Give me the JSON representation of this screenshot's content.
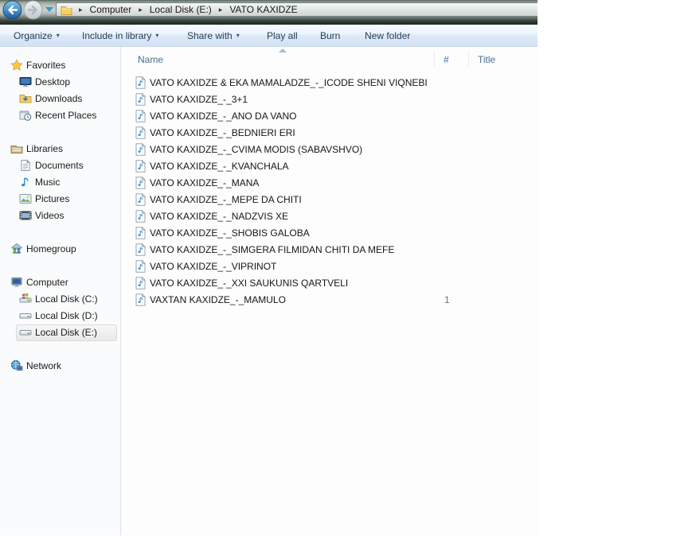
{
  "breadcrumb": {
    "items": [
      "Computer",
      "Local Disk (E:)",
      "VATO KAXIDZE"
    ]
  },
  "toolbar": {
    "items": [
      {
        "label": "Organize",
        "dropdown": true
      },
      {
        "label": "Include in library",
        "dropdown": true
      },
      {
        "label": "Share with",
        "dropdown": true
      },
      {
        "label": "Play all",
        "dropdown": false
      },
      {
        "label": "Burn",
        "dropdown": false
      },
      {
        "label": "New folder",
        "dropdown": false
      }
    ]
  },
  "sidebar": {
    "groups": [
      {
        "label": "Favorites",
        "icon": "favorites-star-icon",
        "children": [
          {
            "label": "Desktop",
            "icon": "desktop-icon"
          },
          {
            "label": "Downloads",
            "icon": "downloads-icon"
          },
          {
            "label": "Recent Places",
            "icon": "recent-places-icon"
          }
        ]
      },
      {
        "label": "Libraries",
        "icon": "libraries-icon",
        "children": [
          {
            "label": "Documents",
            "icon": "documents-icon"
          },
          {
            "label": "Music",
            "icon": "music-icon"
          },
          {
            "label": "Pictures",
            "icon": "pictures-icon"
          },
          {
            "label": "Videos",
            "icon": "videos-icon"
          }
        ]
      },
      {
        "label": "Homegroup",
        "icon": "homegroup-icon",
        "children": []
      },
      {
        "label": "Computer",
        "icon": "computer-icon",
        "children": [
          {
            "label": "Local Disk (C:)",
            "icon": "system-drive-icon"
          },
          {
            "label": "Local Disk (D:)",
            "icon": "drive-icon"
          },
          {
            "label": "Local Disk (E:)",
            "icon": "drive-icon",
            "selected": true
          }
        ]
      },
      {
        "label": "Network",
        "icon": "network-icon",
        "children": []
      }
    ]
  },
  "main": {
    "columns": [
      {
        "label": "Name",
        "sorted": "asc"
      },
      {
        "label": "#"
      },
      {
        "label": "Title"
      }
    ],
    "files": [
      {
        "name": "VATO KAXIDZE & EKA MAMALADZE_-_ICODE SHENI VIQNEBI",
        "icon": "music-file-icon",
        "number": ""
      },
      {
        "name": "VATO KAXIDZE_-_3+1",
        "icon": "music-file-icon",
        "number": ""
      },
      {
        "name": "VATO KAXIDZE_-_ANO DA VANO",
        "icon": "music-file-icon",
        "number": ""
      },
      {
        "name": "VATO KAXIDZE_-_BEDNIERI ERI",
        "icon": "music-file-icon",
        "number": ""
      },
      {
        "name": "VATO KAXIDZE_-_CVIMA MODIS (SABAVSHVO)",
        "icon": "music-file-icon",
        "number": ""
      },
      {
        "name": "VATO KAXIDZE_-_KVANCHALA",
        "icon": "music-file-icon",
        "number": ""
      },
      {
        "name": "VATO KAXIDZE_-_MANA",
        "icon": "music-file-icon",
        "number": ""
      },
      {
        "name": "VATO KAXIDZE_-_MEPE DA CHITI",
        "icon": "music-file-icon",
        "number": ""
      },
      {
        "name": "VATO KAXIDZE_-_NADZVIS XE",
        "icon": "music-file-icon",
        "number": ""
      },
      {
        "name": "VATO KAXIDZE_-_SHOBIS GALOBA",
        "icon": "music-file-icon",
        "number": ""
      },
      {
        "name": "VATO KAXIDZE_-_SIMGERA FILMIDAN CHITI DA MEFE",
        "icon": "music-file-icon",
        "number": ""
      },
      {
        "name": "VATO KAXIDZE_-_VIPRINOT",
        "icon": "music-file-icon",
        "number": ""
      },
      {
        "name": "VATO KAXIDZE_-_XXI SAUKUNIS QARTVELI",
        "icon": "music-file-icon",
        "number": ""
      },
      {
        "name": "VAXTAN KAXIDZE_-_MAMULO",
        "icon": "music-file-icon",
        "number": "1"
      }
    ]
  },
  "colors": {
    "toolbar_text": "#1e3c5a",
    "header_text": "#4a6d92",
    "music_note_blue": "#2f8fd4",
    "selection_silver": "#ededed"
  }
}
